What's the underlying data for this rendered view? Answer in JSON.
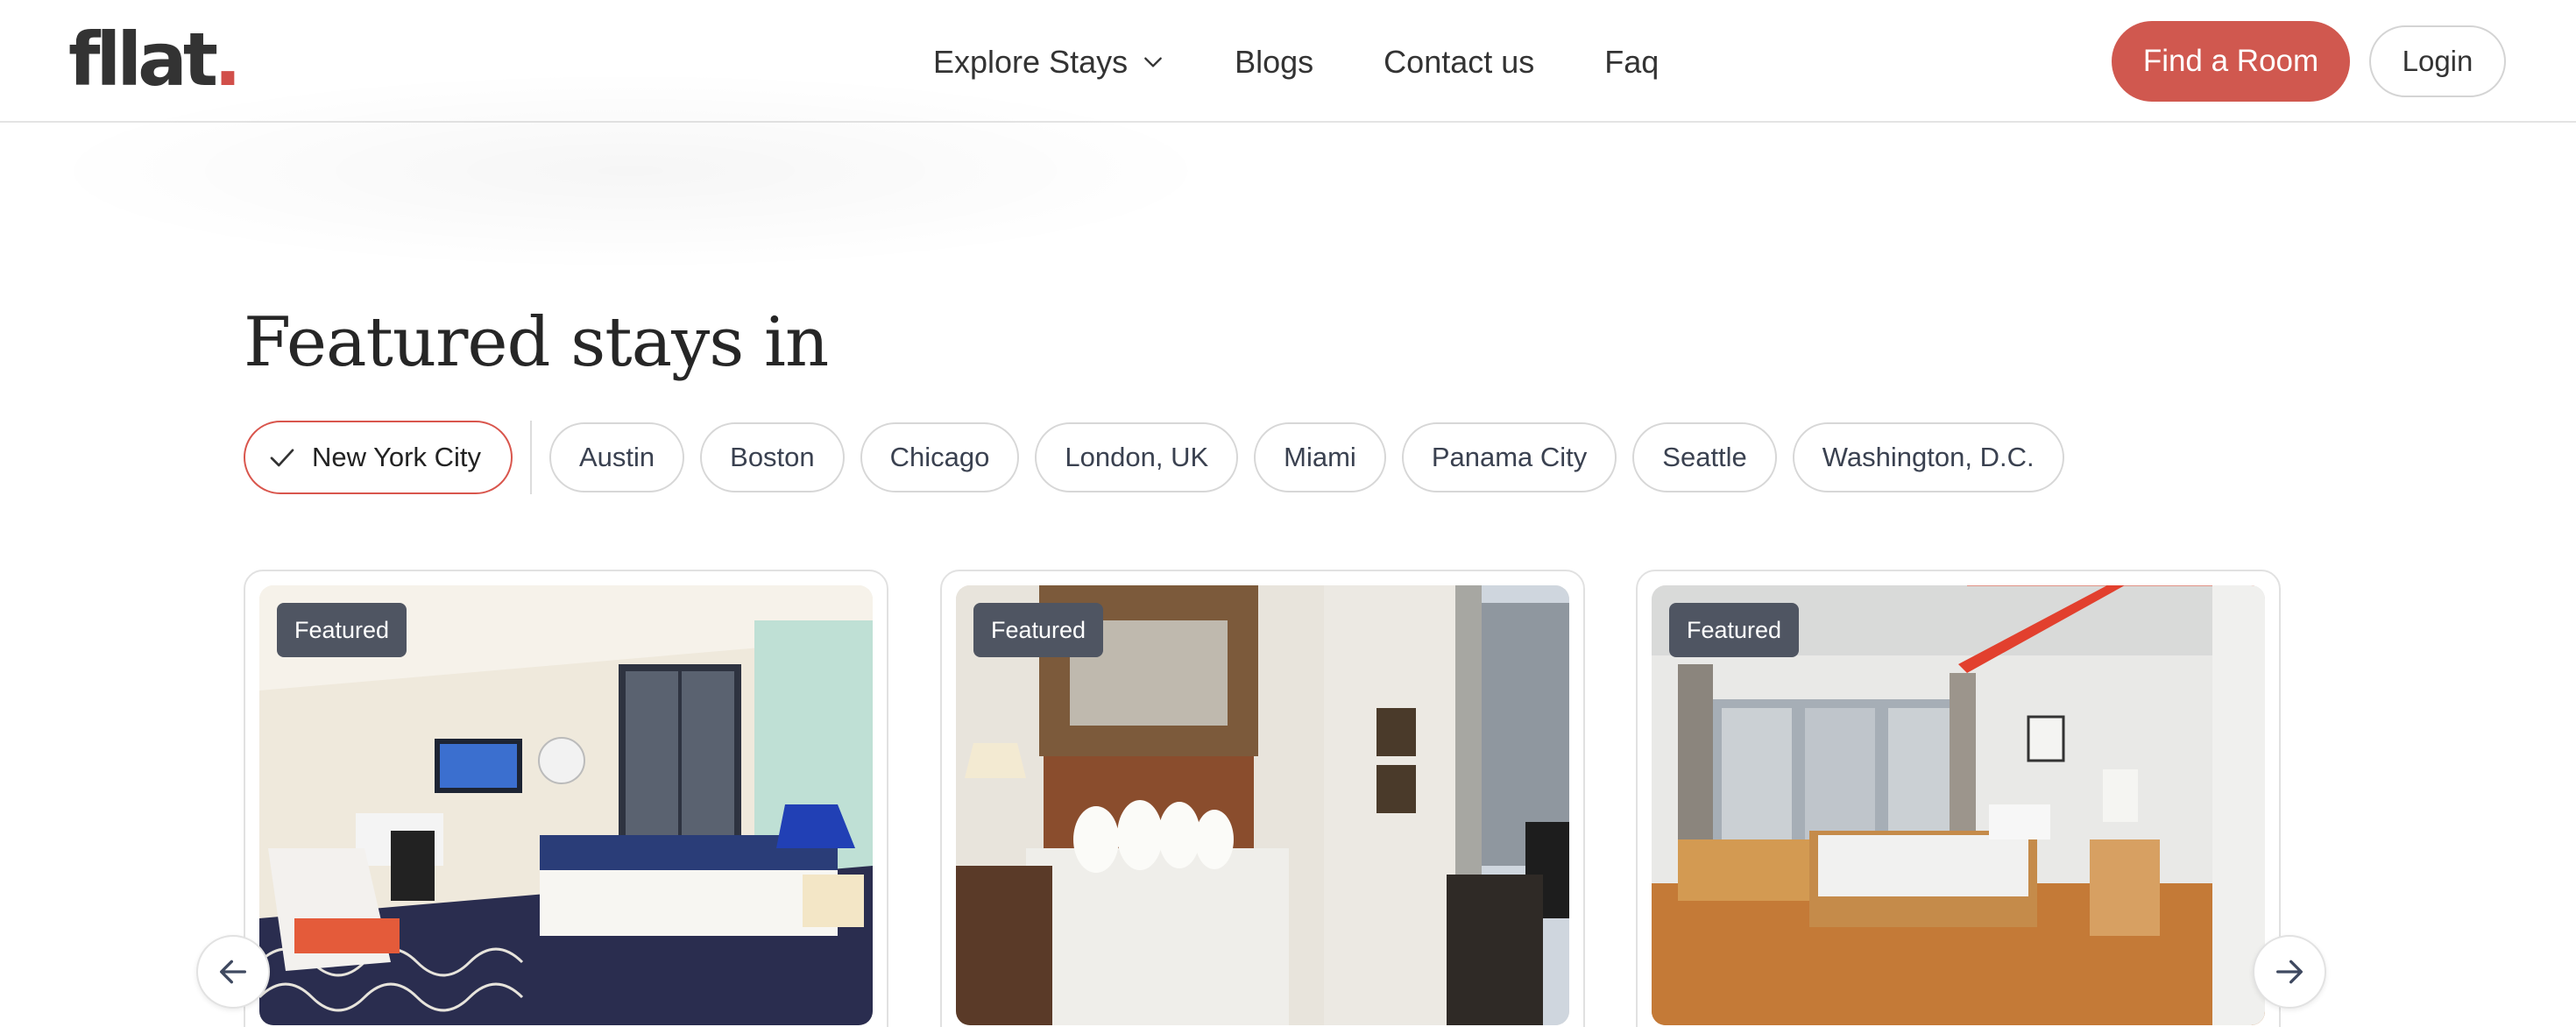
{
  "header": {
    "logo_text": "fllat",
    "logo_dot": ".",
    "nav": [
      {
        "label": "Explore Stays",
        "has_dropdown": true
      },
      {
        "label": "Blogs"
      },
      {
        "label": "Contact us"
      },
      {
        "label": "Faq"
      }
    ],
    "find_room_label": "Find a Room",
    "login_label": "Login"
  },
  "featured": {
    "title": "Featured stays in",
    "cities": [
      {
        "label": "New York City",
        "selected": true
      },
      {
        "label": "Austin"
      },
      {
        "label": "Boston"
      },
      {
        "label": "Chicago"
      },
      {
        "label": "London, UK"
      },
      {
        "label": "Miami"
      },
      {
        "label": "Panama City"
      },
      {
        "label": "Seattle"
      },
      {
        "label": "Washington, D.C."
      }
    ],
    "cards": [
      {
        "badge": "Featured"
      },
      {
        "badge": "Featured"
      },
      {
        "badge": "Featured"
      }
    ]
  },
  "colors": {
    "accent": "#d0584f",
    "badge_bg": "#4f5562",
    "text": "#2f2f2f"
  },
  "icons": {
    "dropdown": "chevron-down-icon",
    "selected": "check-icon",
    "prev": "arrow-left-icon",
    "next": "arrow-right-icon"
  }
}
